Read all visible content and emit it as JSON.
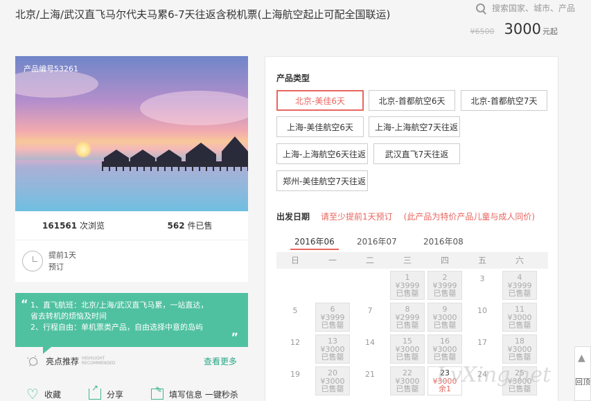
{
  "header": {
    "title": "北京/上海/武汉直飞马尔代夫马累6-7天往返含税机票(上海航空起止可配全国联运)",
    "search_placeholder": "搜索国家、城市、产品"
  },
  "price": {
    "original": "¥6500",
    "current": "3000",
    "unit": "元起"
  },
  "product": {
    "number_label": "产品编号53261",
    "views_count": "161561",
    "views_label": "次浏览",
    "sold_count": "562",
    "sold_label": "件已售",
    "advance_line1": "提前1天",
    "advance_line2": "预订"
  },
  "feature": {
    "line1": "1、直飞航班：北京/上海/武汉直飞马累，一站直达，",
    "line2": "省去转机的烦恼及时间",
    "line3": "2、行程自由：单机票类产品，自由选择中意的岛屿"
  },
  "recommend": {
    "title": "亮点推荐",
    "en_line1": "HIGHLIGHT",
    "en_line2": "RECOMMENDED",
    "more": "查看更多"
  },
  "actions": {
    "favorite": "收藏",
    "share": "分享",
    "fill": "填写信息 一键秒杀"
  },
  "panel": {
    "type_title": "产品类型",
    "types": [
      {
        "label": "北京-美佳6天",
        "active": true
      },
      {
        "label": "北京-首都航空6天",
        "active": false
      },
      {
        "label": "北京-首都航空7天",
        "active": false
      },
      {
        "label": "上海-美佳航空6天",
        "active": false
      },
      {
        "label": "上海-上海航空7天往返",
        "active": false
      },
      {
        "label": "上海-上海航空6天往返",
        "active": false
      },
      {
        "label": "武汉直飞7天往返",
        "active": false
      },
      {
        "label": "郑州-美佳航空7天往返",
        "active": false
      }
    ],
    "date_title": "出发日期",
    "date_hint": "请至少提前1天预订",
    "date_note": "(此产品为特价产品儿童与成人同价)",
    "months": [
      "2016年06",
      "2016年07",
      "2016年08"
    ],
    "weekdays": [
      "日",
      "一",
      "二",
      "三",
      "四",
      "五",
      "六"
    ],
    "days": [
      {
        "day": "",
        "price": "",
        "status": ""
      },
      {
        "day": "",
        "price": "",
        "status": ""
      },
      {
        "day": "",
        "price": "",
        "status": ""
      },
      {
        "day": "1",
        "price": "¥3999",
        "status": "已售罄"
      },
      {
        "day": "2",
        "price": "¥3999",
        "status": "已售罄"
      },
      {
        "day": "3",
        "price": "",
        "status": ""
      },
      {
        "day": "4",
        "price": "¥3999",
        "status": "已售罄"
      },
      {
        "day": "5",
        "price": "",
        "status": ""
      },
      {
        "day": "6",
        "price": "¥3999",
        "status": "已售罄"
      },
      {
        "day": "7",
        "price": "",
        "status": ""
      },
      {
        "day": "8",
        "price": "¥2999",
        "status": "已售罄"
      },
      {
        "day": "9",
        "price": "¥3000",
        "status": "已售罄"
      },
      {
        "day": "10",
        "price": "",
        "status": ""
      },
      {
        "day": "11",
        "price": "¥3000",
        "status": "已售罄"
      },
      {
        "day": "12",
        "price": "",
        "status": ""
      },
      {
        "day": "13",
        "price": "¥3000",
        "status": "已售罄"
      },
      {
        "day": "14",
        "price": "",
        "status": ""
      },
      {
        "day": "15",
        "price": "¥3000",
        "status": "已售罄"
      },
      {
        "day": "16",
        "price": "¥3000",
        "status": "已售罄"
      },
      {
        "day": "17",
        "price": "",
        "status": ""
      },
      {
        "day": "18",
        "price": "¥3000",
        "status": "已售罄"
      },
      {
        "day": "19",
        "price": "",
        "status": ""
      },
      {
        "day": "20",
        "price": "¥3000",
        "status": "已售罄"
      },
      {
        "day": "21",
        "price": "",
        "status": ""
      },
      {
        "day": "22",
        "price": "¥3000",
        "status": "已售罄"
      },
      {
        "day": "23",
        "price": "¥3000",
        "status": "余1",
        "available": true
      },
      {
        "day": "24",
        "price": "",
        "status": ""
      },
      {
        "day": "25",
        "price": "¥3000",
        "status": "已售罄"
      }
    ]
  },
  "side": {
    "back_top": "回顶"
  },
  "watermark": "LvXing.net"
}
